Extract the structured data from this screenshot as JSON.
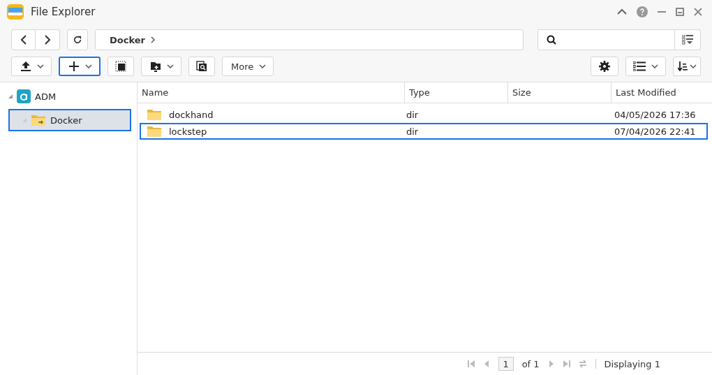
{
  "window": {
    "title": "File Explorer"
  },
  "breadcrumb": [
    {
      "label": "Docker"
    }
  ],
  "toolbar": [
    {
      "kind": "upload",
      "dropdown": true,
      "focused": false
    },
    {
      "kind": "new",
      "dropdown": true,
      "focused": true
    },
    {
      "kind": "select",
      "dropdown": false,
      "focused": false
    },
    {
      "kind": "share",
      "dropdown": true,
      "focused": false
    },
    {
      "kind": "find",
      "dropdown": false,
      "focused": false
    },
    {
      "kind": "text",
      "label": "More",
      "dropdown": true,
      "focused": false
    }
  ],
  "tree": [
    {
      "label": "ADM",
      "kind": "root",
      "expanded": true,
      "selected": false,
      "children": [
        {
          "label": "Docker",
          "kind": "folder",
          "expanded": false,
          "selected": true
        }
      ]
    }
  ],
  "table": {
    "columns": [
      "Name",
      "Type",
      "Size",
      "Last Modified"
    ],
    "rows": [
      {
        "name": "dockhand",
        "type": "dir",
        "modified": "04/05/2026 17:36",
        "selected": false
      },
      {
        "name": "lockstep",
        "type": "dir",
        "modified": "07/04/2026 22:41",
        "selected": true
      }
    ]
  },
  "pager": {
    "page": "1",
    "of": "of 1",
    "status": "Displaying 1"
  }
}
